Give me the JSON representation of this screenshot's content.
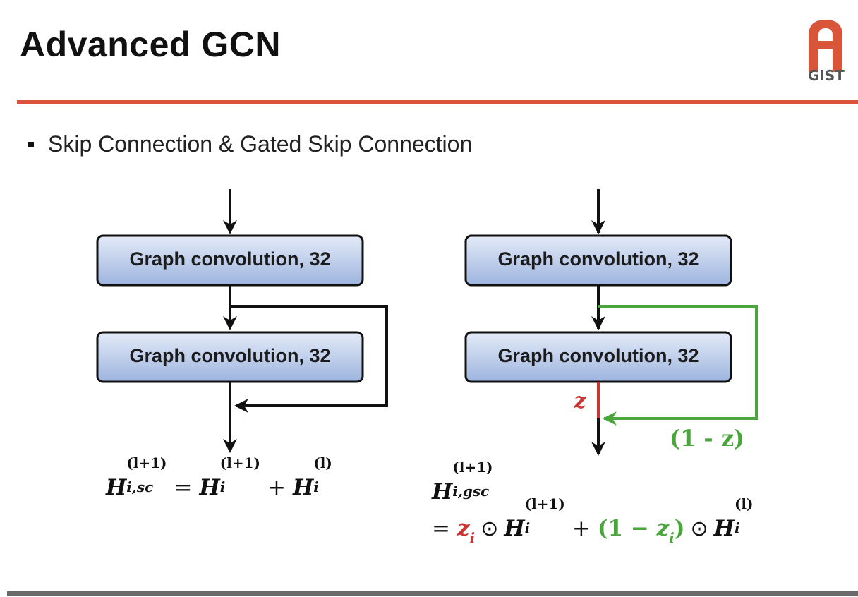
{
  "slide": {
    "title": "Advanced GCN",
    "logo_text": "GIST",
    "bullet": "Skip Connection & Gated Skip Connection"
  },
  "diagram": {
    "left": {
      "box1": "Graph convolution, 32",
      "box2": "Graph convolution, 32"
    },
    "right": {
      "box1": "Graph convolution, 32",
      "box2": "Graph convolution, 32",
      "gate_label": "z",
      "skip_label": "(1 - z)"
    }
  },
  "formulas": {
    "sc": {
      "H": "H",
      "sub_sc": "i,sc",
      "sup_next": "(l+1)",
      "eq": "=",
      "sub_i": "i",
      "plus": "+",
      "sup_cur": "(l)"
    },
    "gsc": {
      "H": "H",
      "sub_gsc": "i,gsc",
      "sup_next": "(l+1)",
      "eq": "=",
      "z": "z",
      "sub_i": "i",
      "odot": "⊙",
      "plus": "+",
      "one_minus_z_open": "(1 −",
      "close": ")",
      "sup_cur": "(l)"
    }
  },
  "colors": {
    "accent_rule": "#d9533b",
    "box_fill_top": "#dde6f6",
    "box_fill_bottom": "#9fb6df",
    "gate_red": "#cc3333",
    "skip_green": "#4aa63c"
  }
}
